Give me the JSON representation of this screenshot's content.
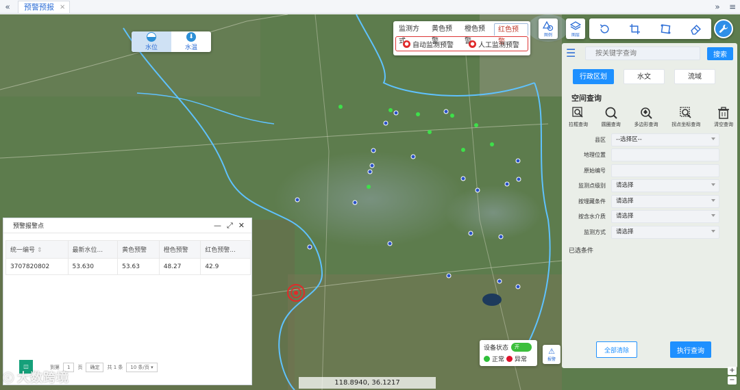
{
  "tabbar": {
    "prev_icon": "double-chevron-left",
    "tab_label": "预警预报",
    "tab_close": "×",
    "next_icon": "double-chevron-right",
    "menu_icon": "hamburger"
  },
  "layer_switch": {
    "items": [
      {
        "label": "水位",
        "icon": "water-level-icon",
        "active": true
      },
      {
        "label": "水温",
        "icon": "water-temperature-icon",
        "active": false
      }
    ]
  },
  "warning_panel": {
    "tabs": [
      "监测方式",
      "黄色预警",
      "橙色预警",
      "红色预警"
    ],
    "active_tab": "红色预警",
    "sub_items": [
      "自动监测预警",
      "人工监测预警"
    ],
    "colors": {
      "red": "#e02a2a"
    }
  },
  "map_tools": {
    "layer_label": "图层",
    "shape_label": "图例"
  },
  "sidebar": {
    "search_placeholder": "按关键字查询",
    "search_button": "搜索",
    "tabs": [
      "行政区划",
      "水文",
      "流域"
    ],
    "active_tab": "行政区划",
    "section_title": "空间查询",
    "tools": [
      "拉框查询",
      "圆圈查询",
      "多边形查询",
      "拐点坐标查询",
      "清空查询"
    ],
    "form": [
      {
        "label": "县区",
        "value": "--选择区--",
        "dropdown": true
      },
      {
        "label": "地理位置",
        "value": "",
        "dropdown": false
      },
      {
        "label": "原始编号",
        "value": "",
        "dropdown": false
      },
      {
        "label": "监测点级别",
        "value": "请选择",
        "dropdown": true
      },
      {
        "label": "按埋藏条件",
        "value": "请选择",
        "dropdown": true
      },
      {
        "label": "按含水介质",
        "value": "请选择",
        "dropdown": true
      },
      {
        "label": "监测方式",
        "value": "请选择",
        "dropdown": true
      }
    ],
    "chosen_label": "已选条件",
    "clear_button": "全部清除",
    "exec_button": "执行查询",
    "accent": "#1e90ff"
  },
  "alarm_table": {
    "title": "预警报警点",
    "columns": [
      "统一编号",
      "最新水位...",
      "黄色预警",
      "橙色预警",
      "红色预警..."
    ],
    "rows": [
      [
        "3707820802",
        "53.630",
        "53.63",
        "48.27",
        "42.9"
      ]
    ],
    "pager": {
      "goto_prefix": "到第",
      "page": "1",
      "goto_suffix": "页",
      "confirm": "确定",
      "total": "共 1 条",
      "page_size": "10 条/页"
    }
  },
  "device_status": {
    "label": "设备状态",
    "toggle": "开",
    "normal": "正常",
    "abnormal": "异常",
    "colors": {
      "normal": "#2fbf3a",
      "abnormal": "#e0102a"
    }
  },
  "alarm_button_label": "报警",
  "coordinates": "118.8940, 36.1217",
  "watermark": "大数跨境",
  "zoom": {
    "in": "+",
    "out": "−"
  },
  "map_markers": {
    "colors": {
      "monitor": "#2a52c8",
      "green": "#3ee04a",
      "alert": "#e02a2a"
    }
  }
}
